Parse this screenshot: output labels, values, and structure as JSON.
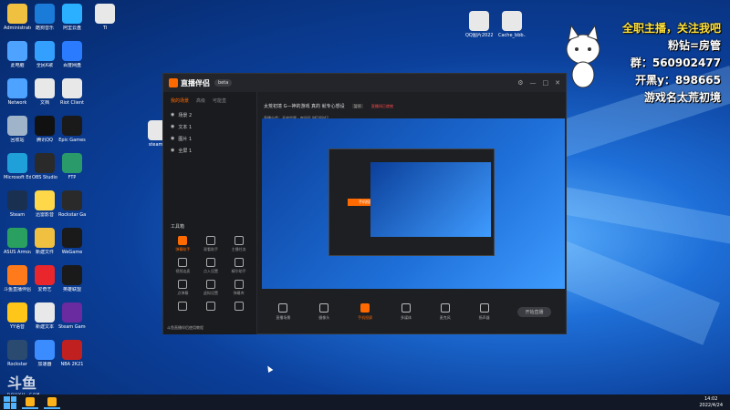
{
  "colors": {
    "accent": "#ff6a00",
    "overlay_yellow": "#ffe23d",
    "desktop_blue": "#1e6fd8"
  },
  "desktop": {
    "col1": [
      {
        "label": "Administrator",
        "icon": "user-folder-icon",
        "color": "#f0c040"
      },
      {
        "label": "此电脑",
        "icon": "computer-icon",
        "color": "#4da3ff"
      },
      {
        "label": "Network",
        "icon": "network-icon",
        "color": "#4da3ff"
      },
      {
        "label": "回收站",
        "icon": "recycle-bin-icon",
        "color": "#9fb4c8"
      },
      {
        "label": "Microsoft Edge",
        "icon": "edge-icon",
        "color": "#20a0d8"
      },
      {
        "label": "Steam",
        "icon": "steam-icon",
        "color": "#1a3050"
      },
      {
        "label": "ASUS Armoury",
        "icon": "globe-icon",
        "color": "#2aa060"
      },
      {
        "label": "斗鱼直播伴侣",
        "icon": "douyu-icon",
        "color": "#ff7a1a"
      },
      {
        "label": "YY语音",
        "icon": "yy-icon",
        "color": "#ffc61a"
      },
      {
        "label": "Rockstar",
        "icon": "game-icon",
        "color": "#2a4a70"
      }
    ],
    "col2": [
      {
        "label": "酷狗音乐",
        "icon": "kugou-icon",
        "color": "#1a7bd8"
      },
      {
        "label": "全民K歌",
        "icon": "music-icon",
        "color": "#33a0ff"
      },
      {
        "label": "文档",
        "icon": "document-icon",
        "color": "#e8e8e8"
      },
      {
        "label": "腾讯QQ",
        "icon": "qq-icon",
        "color": "#111111"
      },
      {
        "label": "OBS Studio",
        "icon": "obs-icon",
        "color": "#2a2a2a"
      },
      {
        "label": "迅雷影音",
        "icon": "xunlei-icon",
        "color": "#ffd84a"
      },
      {
        "label": "新建文件",
        "icon": "file-icon",
        "color": "#f0c040"
      },
      {
        "label": "爱奇艺",
        "icon": "iqiyi-icon",
        "color": "#e8262b"
      },
      {
        "label": "新建文本",
        "icon": "text-file-icon",
        "color": "#e8e8e8"
      },
      {
        "label": "加速器",
        "icon": "plane-icon",
        "color": "#3a8cff"
      }
    ],
    "col3": [
      {
        "label": "阿里云盘",
        "icon": "cloud-icon",
        "color": "#2ab0ff"
      },
      {
        "label": "百度网盘",
        "icon": "baidu-icon",
        "color": "#2a7bff"
      },
      {
        "label": "Riot Client",
        "icon": "riot-icon",
        "color": "#e8e8e8"
      },
      {
        "label": "Epic Games",
        "icon": "epic-icon",
        "color": "#1a1a1a"
      },
      {
        "label": "FTP",
        "icon": "ftp-icon",
        "color": "#2a9a6a"
      },
      {
        "label": "Rockstar Games",
        "icon": "rockstar-icon",
        "color": "#2a2a2a"
      },
      {
        "label": "WeGame",
        "icon": "wegame-icon",
        "color": "#1a1a1a"
      },
      {
        "label": "英雄联盟",
        "icon": "lol-icon",
        "color": "#1a1a1a"
      },
      {
        "label": "Steam Game",
        "icon": "game2-icon",
        "color": "#6a2aa0"
      },
      {
        "label": "NBA 2K21",
        "icon": "nba2k-icon",
        "color": "#c02020"
      }
    ],
    "extra": [
      {
        "label": "QQ图片2022...",
        "icon": "image-file-icon",
        "color": "#e8e8e8"
      },
      {
        "label": "Cache_bbb...",
        "icon": "cache-file-icon",
        "color": "#e8e8e8"
      },
      {
        "label": "TI",
        "icon": "txt-file-icon",
        "color": "#e8e8e8"
      },
      {
        "label": "steam...",
        "icon": "shortcut-icon",
        "color": "#e8e8e8"
      }
    ]
  },
  "overlay": {
    "line1": "全职主播，关注我吧",
    "line2": "粉钻=房管",
    "line3": "群：560902477",
    "line4": "开黑y：898665",
    "line5": "游戏名太荒初境"
  },
  "app": {
    "title": "直播伴侣",
    "version": "beta",
    "side_tabs": [
      "我的场景",
      "高级",
      "可能直"
    ],
    "scenes": [
      "场景 2",
      "文本 1",
      "图片 1",
      "全屏 1"
    ],
    "tools_title": "工具箱",
    "tools": [
      "弹幕助手",
      "观看助手",
      "主播任务",
      "视频连麦",
      "点入设置",
      "精华助手",
      "点弹幕",
      "虚拟设置",
      "弹幕库",
      "",
      "",
      ""
    ],
    "sidebar_footer": "斗鱼直播伴侣使用教程",
    "stream_title": "太荒初境 G—神的游戏 真的 就专心想设",
    "stream_tag": "暂停",
    "stream_warn": "直播间已就绪",
    "stream_sub": "直播分类：开放世界 · 房间号 9626842",
    "inner_label": "手机投屏",
    "bottom_buttons": [
      "直播场景",
      "摄像头",
      "手机投屏",
      "多媒体",
      "麦克风",
      "扬声器"
    ],
    "start_label": "开始直播"
  },
  "watermark": {
    "big": "斗鱼",
    "small": "DOUYU.COM"
  },
  "taskbar": {
    "time": "14:02",
    "date": "2022/4/24"
  }
}
